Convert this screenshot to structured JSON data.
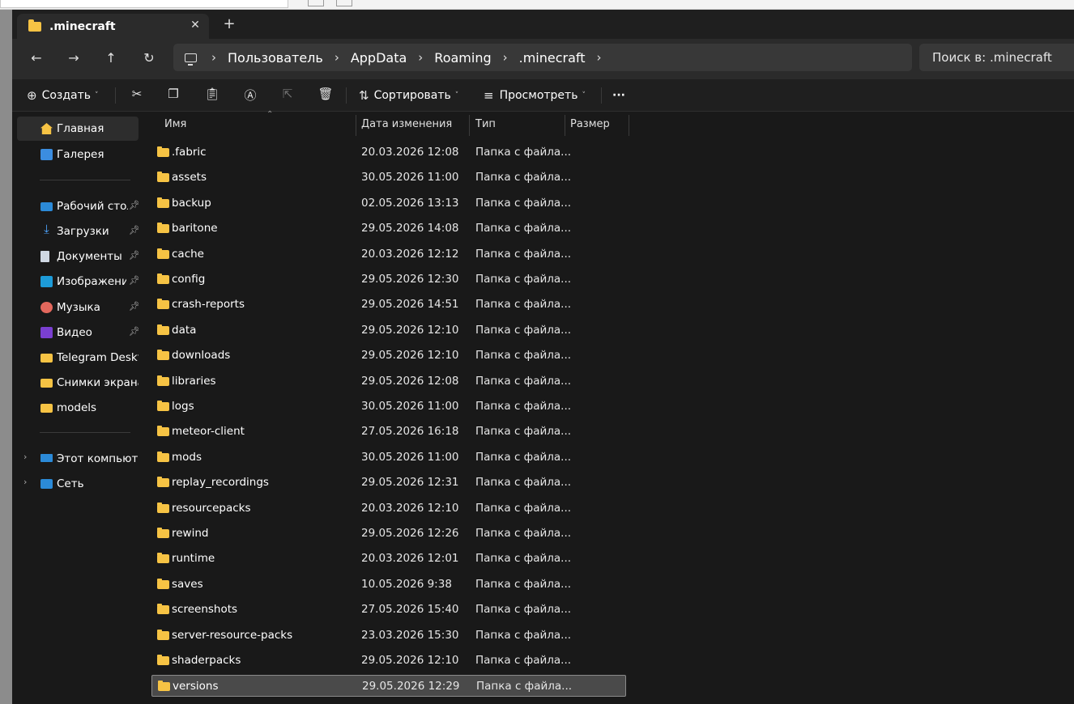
{
  "tab": {
    "title": ".minecraft",
    "close": "✕",
    "add": "+"
  },
  "nav": {
    "back": "←",
    "forward": "→",
    "up": "↑",
    "refresh": "↻"
  },
  "address": {
    "crumbs": [
      "Пользователь",
      "AppData",
      "Roaming",
      ".minecraft"
    ],
    "separator": "›"
  },
  "search": {
    "placeholder": "Поиск в: .minecraft"
  },
  "toolbar": {
    "new_label": "Создать",
    "sort_label": "Сортировать",
    "view_label": "Просмотреть",
    "more": "···"
  },
  "sidebar": {
    "quick": [
      {
        "label": "Главная"
      },
      {
        "label": "Галерея"
      }
    ],
    "pinned": [
      {
        "label": "Рабочий стол"
      },
      {
        "label": "Загрузки"
      },
      {
        "label": "Документы"
      },
      {
        "label": "Изображения"
      },
      {
        "label": "Музыка"
      },
      {
        "label": "Видео"
      },
      {
        "label": "Telegram Desktop"
      },
      {
        "label": "Снимки экрана"
      },
      {
        "label": "models"
      }
    ],
    "places": [
      {
        "label": "Этот компьютер"
      },
      {
        "label": "Сеть"
      }
    ]
  },
  "columns": {
    "name": "Имя",
    "modified": "Дата изменения",
    "type": "Тип",
    "size": "Размер"
  },
  "files": [
    {
      "name": ".fabric",
      "modified": "20.03.2026 12:08",
      "type": "Папка с файла..."
    },
    {
      "name": "assets",
      "modified": "30.05.2026 11:00",
      "type": "Папка с файла..."
    },
    {
      "name": "backup",
      "modified": "02.05.2026 13:13",
      "type": "Папка с файла..."
    },
    {
      "name": "baritone",
      "modified": "29.05.2026 14:08",
      "type": "Папка с файла..."
    },
    {
      "name": "cache",
      "modified": "20.03.2026 12:12",
      "type": "Папка с файла..."
    },
    {
      "name": "config",
      "modified": "29.05.2026 12:30",
      "type": "Папка с файла..."
    },
    {
      "name": "crash-reports",
      "modified": "29.05.2026 14:51",
      "type": "Папка с файла..."
    },
    {
      "name": "data",
      "modified": "29.05.2026 12:10",
      "type": "Папка с файла..."
    },
    {
      "name": "downloads",
      "modified": "29.05.2026 12:10",
      "type": "Папка с файла..."
    },
    {
      "name": "libraries",
      "modified": "29.05.2026 12:08",
      "type": "Папка с файла..."
    },
    {
      "name": "logs",
      "modified": "30.05.2026 11:00",
      "type": "Папка с файла..."
    },
    {
      "name": "meteor-client",
      "modified": "27.05.2026 16:18",
      "type": "Папка с файла..."
    },
    {
      "name": "mods",
      "modified": "30.05.2026 11:00",
      "type": "Папка с файла..."
    },
    {
      "name": "replay_recordings",
      "modified": "29.05.2026 12:31",
      "type": "Папка с файла..."
    },
    {
      "name": "resourcepacks",
      "modified": "20.03.2026 12:10",
      "type": "Папка с файла..."
    },
    {
      "name": "rewind",
      "modified": "29.05.2026 12:26",
      "type": "Папка с файла..."
    },
    {
      "name": "runtime",
      "modified": "20.03.2026 12:01",
      "type": "Папка с файла..."
    },
    {
      "name": "saves",
      "modified": "10.05.2026 9:38",
      "type": "Папка с файла..."
    },
    {
      "name": "screenshots",
      "modified": "27.05.2026 15:40",
      "type": "Папка с файла..."
    },
    {
      "name": "server-resource-packs",
      "modified": "23.03.2026 15:30",
      "type": "Папка с файла..."
    },
    {
      "name": "shaderpacks",
      "modified": "29.05.2026 12:10",
      "type": "Папка с файла..."
    },
    {
      "name": "versions",
      "modified": "29.05.2026 12:29",
      "type": "Папка с файла...",
      "selected": true
    }
  ],
  "colors": {
    "accent_folder": "#f6c344",
    "background": "#191919",
    "selection": "#4a4a4a"
  }
}
